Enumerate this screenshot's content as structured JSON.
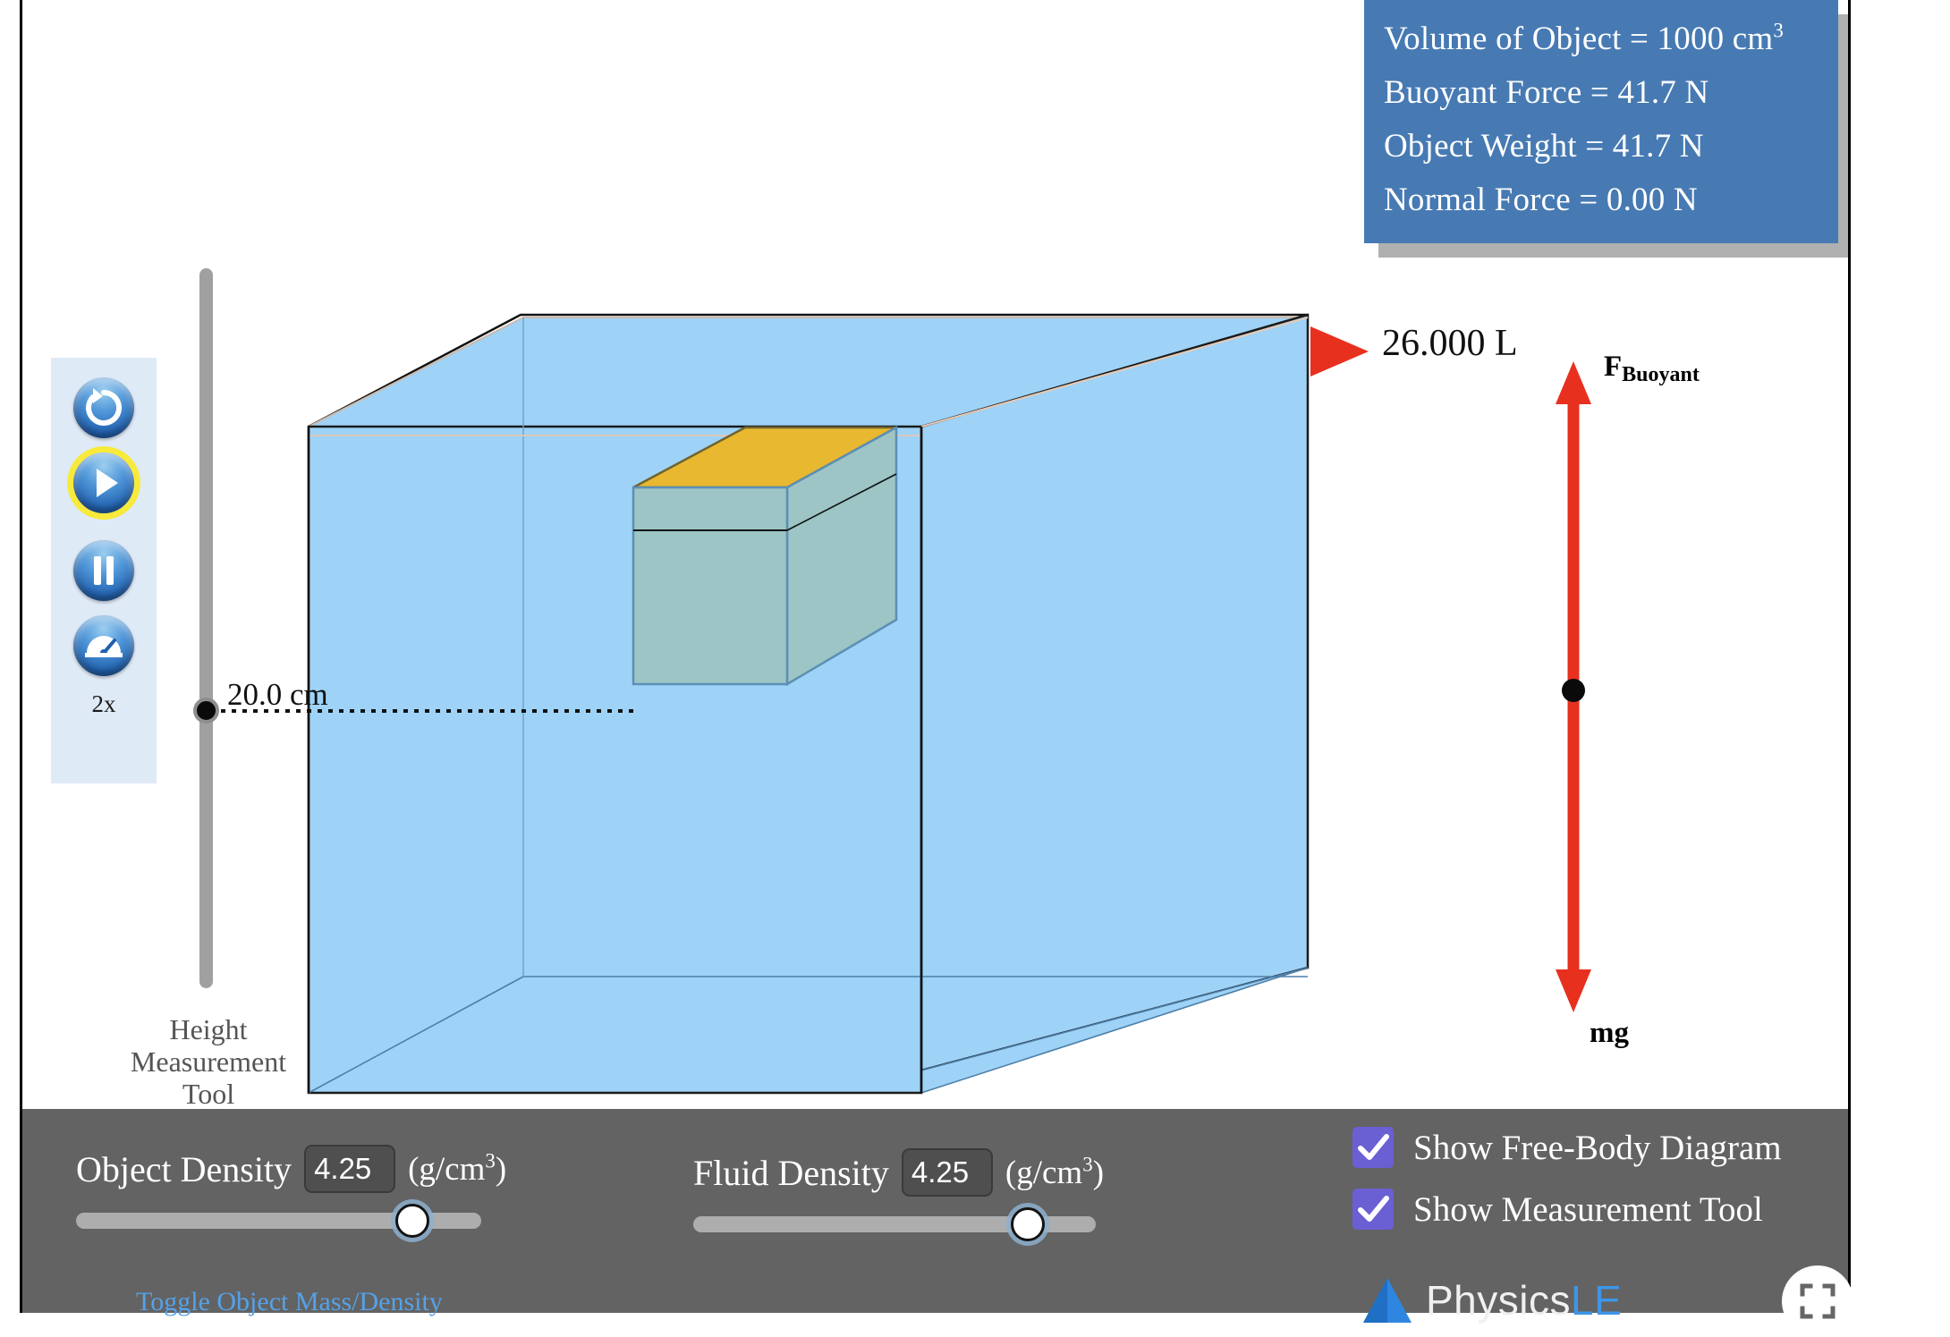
{
  "info_panel": {
    "lines": [
      {
        "text": "Volume of Object = 1000 cm",
        "sup": "3"
      },
      {
        "text": "Buoyant Force = 41.7 N",
        "sup": ""
      },
      {
        "text": "Object Weight = 41.7 N",
        "sup": ""
      },
      {
        "text": "Normal Force = 0.00 N",
        "sup": ""
      }
    ],
    "volume_of_object": "1000 cm³",
    "buoyant_force": "41.7 N",
    "object_weight": "41.7 N",
    "normal_force": "0.00 N",
    "bg_color": "#477ab3"
  },
  "media_controls": {
    "reset_label": "reset",
    "play_label": "play",
    "pause_label": "pause",
    "speed_label": "speed",
    "speed_value": "2x",
    "active": "play",
    "panel_color": "#dfeaf7"
  },
  "measurement_tool": {
    "value": "20.0 cm",
    "caption_line1": "Height",
    "caption_line2": "Measurement",
    "caption_line3": "Tool"
  },
  "tank": {
    "volume_readout": "26.000 L",
    "water_color": "#9ed3f7",
    "object_top_color": "#e8b830",
    "object_side_color": "#9dc3c0"
  },
  "free_body_diagram": {
    "up_force_label": "F",
    "up_force_subscript": "Buoyant",
    "down_force_label": "mg",
    "arrow_color": "#e8301f"
  },
  "controls": {
    "object_density": {
      "label": "Object Density",
      "value": "4.25",
      "units": "(g/cm",
      "units_sup": "3",
      "units_close": ")",
      "slider_percent": 83
    },
    "fluid_density": {
      "label": "Fluid Density",
      "value": "4.25",
      "units": "(g/cm",
      "units_sup": "3",
      "units_close": ")",
      "slider_percent": 83
    },
    "toggle_link": "Toggle Object Mass/Density",
    "checkboxes": [
      {
        "label": "Show Free-Body Diagram",
        "checked": true
      },
      {
        "label": "Show Measurement Tool",
        "checked": true
      }
    ],
    "bar_color": "#636363",
    "checkbox_color": "#6b5fd4"
  },
  "branding": {
    "name_part1": "Physics",
    "name_part2": "LE",
    "fullscreen_label": "fullscreen"
  }
}
